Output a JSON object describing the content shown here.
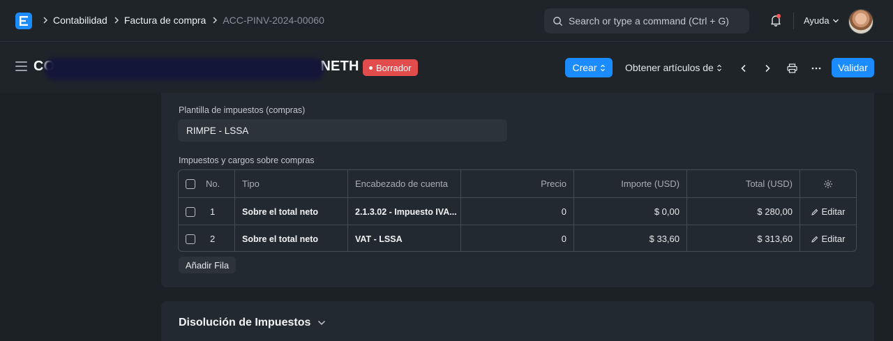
{
  "navbar": {
    "breadcrumbs": [
      "Contabilidad",
      "Factura de compra",
      "ACC-PINV-2024-00060"
    ],
    "search_placeholder": "Search or type a command (Ctrl + G)",
    "help_label": "Ayuda"
  },
  "header": {
    "title": "CONTRERAS SANTANDER FARIA KARINA JEANETH",
    "title_visible_start": "CO",
    "title_visible_end": "NETH",
    "status_badge": "Borrador",
    "create_label": "Crear",
    "get_items_label": "Obtener artículos de",
    "submit_label": "Validar"
  },
  "taxes": {
    "template_label": "Plantilla de impuestos (compras)",
    "template_value": "RIMPE - LSSA",
    "table_label": "Impuestos y cargos sobre compras",
    "columns": [
      "No.",
      "Tipo",
      "Encabezado de cuenta",
      "Precio",
      "Importe (USD)",
      "Total (USD)"
    ],
    "rows": [
      {
        "no": "1",
        "type": "Sobre el total neto",
        "account": "2.1.3.02 - Impuesto IVA...",
        "rate": "0",
        "amount": "$ 0,00",
        "total": "$ 280,00",
        "edit": "Editar"
      },
      {
        "no": "2",
        "type": "Sobre el total neto",
        "account": "VAT - LSSA",
        "rate": "0",
        "amount": "$ 33,60",
        "total": "$ 313,60",
        "edit": "Editar"
      }
    ],
    "add_row_label": "Añadir Fila"
  },
  "section2": {
    "title": "Disolución de Impuestos"
  },
  "colors": {
    "background": "#1c2126",
    "accent": "#1a8cff",
    "badge_red": "#e24c4c"
  }
}
